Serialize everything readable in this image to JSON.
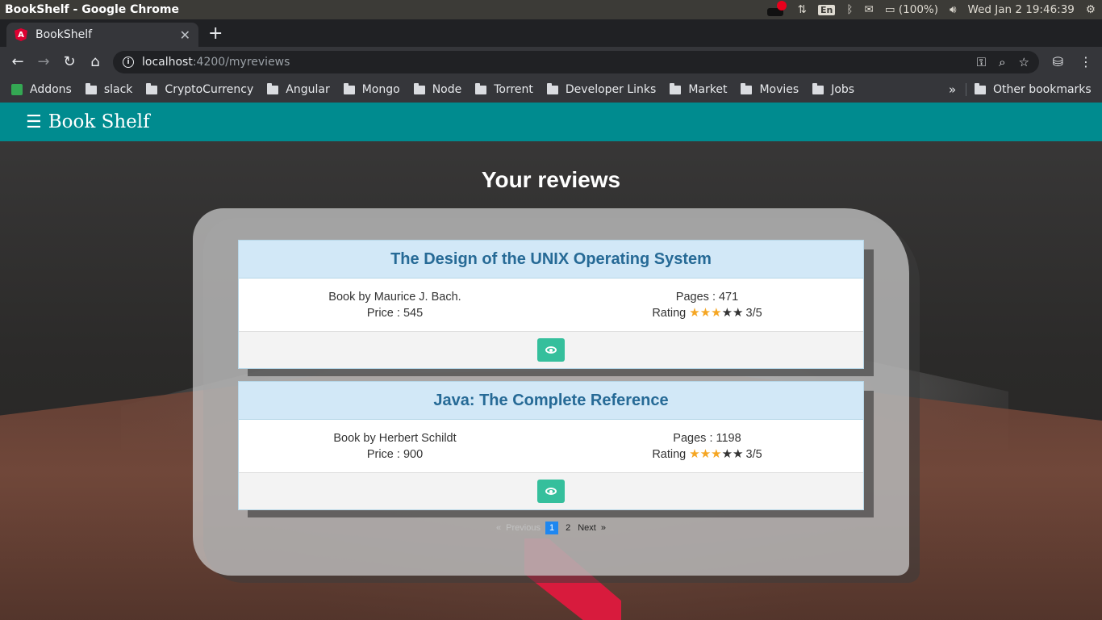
{
  "os": {
    "window_title": "BookShelf - Google Chrome",
    "lang": "En",
    "battery": "(100%)",
    "datetime": "Wed Jan  2 19:46:39"
  },
  "browser": {
    "tab_title": "BookShelf",
    "tab_favicon": "A",
    "url_host": "localhost",
    "url_rest": ":4200/myreviews",
    "bookmarks": [
      "Addons",
      "slack",
      "CryptoCurrency",
      "Angular",
      "Mongo",
      "Node",
      "Torrent",
      "Developer Links",
      "Market",
      "Movies",
      "Jobs"
    ],
    "bookmarks_more": "»",
    "other_bookmarks": "Other bookmarks"
  },
  "app": {
    "brand": "Book Shelf",
    "menu_icon": "☰",
    "page_title": "Your reviews",
    "reviews": [
      {
        "title": "The Design of the UNIX Operating System",
        "author": "Book by Maurice J. Bach.",
        "price": "Price : 545",
        "pages": "Pages : 471",
        "rating_label": "Rating",
        "rating": 3,
        "rating_max": 5,
        "rating_text": "3/5"
      },
      {
        "title": "Java: The Complete Reference",
        "author": "Book by Herbert Schildt",
        "price": "Price : 900",
        "pages": "Pages : 1198",
        "rating_label": "Rating",
        "rating": 3,
        "rating_max": 5,
        "rating_text": "3/5"
      }
    ],
    "pagination": {
      "first": "«",
      "previous": "Previous",
      "pages": [
        "1",
        "2"
      ],
      "current": "1",
      "next": "Next",
      "last": "»"
    }
  },
  "colors": {
    "header": "#008b8f",
    "card_head": "#d2e8f7",
    "card_title": "#266a96",
    "view_button": "#35bf9c",
    "star_on": "#f5a623",
    "page_current": "#1e87f0"
  }
}
